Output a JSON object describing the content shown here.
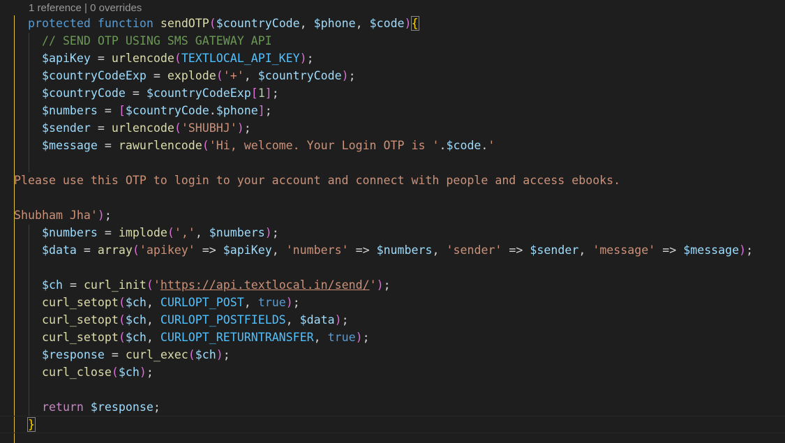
{
  "codelens": "1 reference | 0 overrides",
  "code": {
    "kw_protected": "protected",
    "kw_function": "function",
    "fn_name": "sendOTP",
    "param_country": "$countryCode",
    "param_phone": "$phone",
    "param_code": "$code",
    "comment": "// SEND OTP USING SMS GATEWAY API",
    "v_apiKey": "$apiKey",
    "f_urlencode": "urlencode",
    "c_apikey_const": "TEXTLOCAL_API_KEY",
    "v_countryCodeExp": "$countryCodeExp",
    "f_explode": "explode",
    "s_plus": "'+'",
    "v_countryCode": "$countryCode",
    "n_one": "1",
    "v_numbers": "$numbers",
    "v_phone": "$phone",
    "v_sender": "$sender",
    "s_shubhj": "'SHUBHJ'",
    "v_message": "$message",
    "f_rawurlencode": "rawurlencode",
    "s_msg_start": "'Hi, welcome. Your Login OTP is '",
    "v_code": "$code",
    "s_msg_dot": "'",
    "s_msg_line2": "Please use this OTP to login to your account and connect with people and access ebooks.",
    "s_msg_line3": "Shubham Jha'",
    "f_implode": "implode",
    "s_comma": "','",
    "v_data": "$data",
    "f_array": "array",
    "s_apikey": "'apikey'",
    "s_numbers": "'numbers'",
    "s_sender": "'sender'",
    "s_message": "'message'",
    "v_ch": "$ch",
    "f_curl_init": "curl_init",
    "s_url": "https://api.textlocal.in/send/",
    "f_curl_setopt": "curl_setopt",
    "c_post": "CURLOPT_POST",
    "k_true": "true",
    "c_postfields": "CURLOPT_POSTFIELDS",
    "c_returntransfer": "CURLOPT_RETURNTRANSFER",
    "v_response": "$response",
    "f_curl_exec": "curl_exec",
    "f_curl_close": "curl_close",
    "k_return": "return"
  }
}
